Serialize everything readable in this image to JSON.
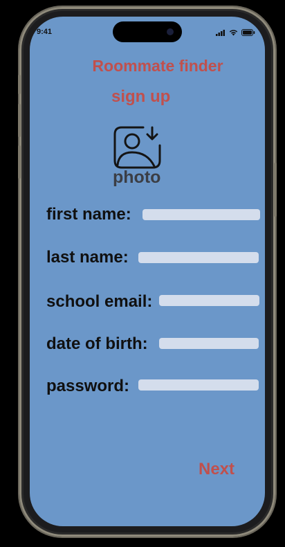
{
  "status_bar": {
    "time": "9:41"
  },
  "header": {
    "app_title": "Roommate finder",
    "page_title": "sign up"
  },
  "photo": {
    "label": "photo",
    "icon": "add-photo-icon"
  },
  "form": {
    "fields": [
      {
        "label": "first name:",
        "value": ""
      },
      {
        "label": "last name:",
        "value": ""
      },
      {
        "label": "school email:",
        "value": ""
      },
      {
        "label": "date of birth:",
        "value": ""
      },
      {
        "label": "password:",
        "value": ""
      }
    ]
  },
  "actions": {
    "next_label": "Next"
  },
  "colors": {
    "accent": "#c0504d",
    "background": "#6b97c9",
    "input": "#d4ddec",
    "text": "#101010"
  }
}
